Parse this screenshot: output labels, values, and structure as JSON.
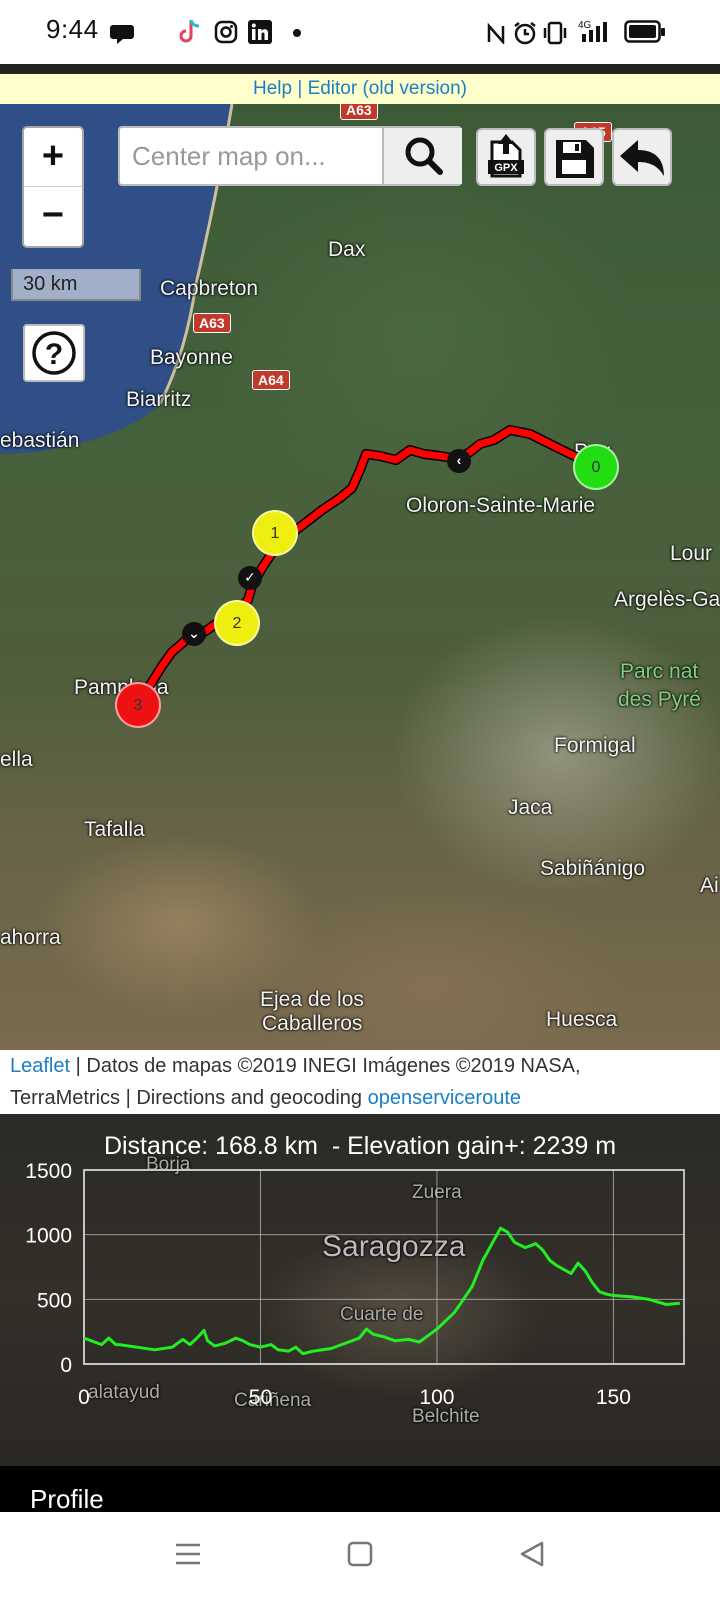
{
  "status_bar": {
    "time": "9:44",
    "network": "4G",
    "icons": [
      "chat-bubble-icon",
      "tiktok-icon",
      "instagram-icon",
      "linkedin-icon",
      "dot-icon",
      "nfc-icon",
      "alarm-icon",
      "vibrate-icon",
      "signal-icon",
      "battery-icon"
    ]
  },
  "help_bar": {
    "help_label": "Help",
    "separator": "|",
    "editor_label": "Editor (old version)"
  },
  "map": {
    "search": {
      "placeholder": "Center map on..."
    },
    "zoom_in_label": "+",
    "zoom_out_label": "−",
    "scale_label": "30 km",
    "help_label": "?",
    "gpx_label": "GPX",
    "place_labels": [
      {
        "id": "dax",
        "text": "Dax"
      },
      {
        "id": "capbreton",
        "text": "Capbreton"
      },
      {
        "id": "bayonne",
        "text": "Bayonne"
      },
      {
        "id": "biarritz",
        "text": "Biarritz"
      },
      {
        "id": "sebastian",
        "text": "ebastián"
      },
      {
        "id": "oloron",
        "text": "Oloron-Sainte-Marie"
      },
      {
        "id": "pau",
        "text": "Pau"
      },
      {
        "id": "lourdes",
        "text": "Lour"
      },
      {
        "id": "argeles",
        "text": "Argelès-Ga"
      },
      {
        "id": "parc1",
        "text": "Parc nat"
      },
      {
        "id": "parc2",
        "text": "des Pyré"
      },
      {
        "id": "pamplona",
        "text": "Pamplona"
      },
      {
        "id": "ella",
        "text": "ella"
      },
      {
        "id": "formigal",
        "text": "Formigal"
      },
      {
        "id": "jaca",
        "text": "Jaca"
      },
      {
        "id": "sabinanigo",
        "text": "Sabiñánigo"
      },
      {
        "id": "a_edge",
        "text": "Ai"
      },
      {
        "id": "tafalla",
        "text": "Tafalla"
      },
      {
        "id": "ahorra",
        "text": "ahorra"
      },
      {
        "id": "ejea1",
        "text": "Ejea de los"
      },
      {
        "id": "ejea2",
        "text": "Caballeros"
      },
      {
        "id": "huesca",
        "text": "Huesca"
      }
    ],
    "road_badges": [
      {
        "id": "a63top",
        "text": "A63"
      },
      {
        "id": "a63",
        "text": "A63"
      },
      {
        "id": "a64",
        "text": "A64"
      },
      {
        "id": "a65",
        "text": "A65"
      }
    ],
    "waypoints": [
      {
        "label": "0",
        "color": "#22dd11"
      },
      {
        "label": "1",
        "color": "#eeee11"
      },
      {
        "label": "2",
        "color": "#eeee11"
      },
      {
        "label": "3",
        "color": "#ee1111"
      }
    ],
    "route_color": "#ff0000"
  },
  "attribution": {
    "leaflet": "Leaflet",
    "line1_rest": " | Datos de mapas ©2019 INEGI Imágenes ©2019 NASA,",
    "line2_prefix": "TerraMetrics | Directions and geocoding ",
    "ors": "openserviceroute"
  },
  "profile": {
    "title": "Distance: 168.8 km  - Elevation gain+: 2239 m",
    "tab_label": "Profile",
    "background_labels": [
      {
        "id": "borja",
        "text": "Borja"
      },
      {
        "id": "zuera",
        "text": "Zuera"
      },
      {
        "id": "saragozza",
        "text": "Saragozza"
      },
      {
        "id": "cuarte",
        "text": "Cuarte de"
      },
      {
        "id": "calatayud",
        "text": "alatayud"
      },
      {
        "id": "carinena",
        "text": "Cariñena"
      },
      {
        "id": "belchite",
        "text": "Belchite"
      }
    ]
  },
  "chart_data": {
    "type": "line",
    "title": "Distance: 168.8 km  - Elevation gain+: 2239 m",
    "xlabel": "",
    "ylabel": "",
    "xlim": [
      0,
      170
    ],
    "ylim": [
      0,
      1500
    ],
    "x_ticks": [
      0,
      50,
      100,
      150
    ],
    "y_ticks": [
      0,
      500,
      1000,
      1500
    ],
    "grid": true,
    "line_color": "#22ee22",
    "series": [
      {
        "x": [
          0,
          3,
          5,
          7,
          9,
          10,
          15,
          20,
          25,
          28,
          30,
          32,
          34,
          35,
          37,
          40,
          43,
          45,
          47,
          50,
          53,
          55,
          58,
          60,
          62,
          65,
          70,
          75,
          78,
          80,
          82,
          85,
          88,
          92,
          95,
          98,
          100,
          105,
          110,
          113,
          116,
          118,
          120,
          122,
          125,
          128,
          130,
          132,
          134,
          138,
          140,
          142,
          144,
          146,
          148,
          150,
          155,
          160,
          165,
          168.8
        ],
        "y": [
          200,
          170,
          150,
          200,
          150,
          150,
          130,
          110,
          130,
          190,
          150,
          200,
          260,
          180,
          140,
          160,
          200,
          180,
          150,
          130,
          150,
          110,
          100,
          130,
          80,
          100,
          120,
          170,
          200,
          270,
          230,
          210,
          180,
          190,
          170,
          230,
          270,
          400,
          600,
          800,
          950,
          1050,
          1020,
          940,
          900,
          930,
          880,
          800,
          760,
          700,
          780,
          720,
          630,
          560,
          540,
          530,
          520,
          500,
          460,
          470
        ]
      }
    ]
  }
}
